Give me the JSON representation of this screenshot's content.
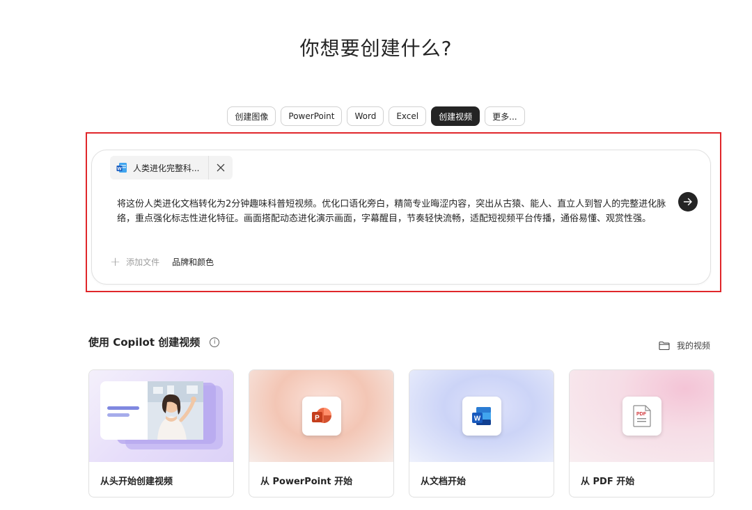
{
  "header": {
    "title": "你想要创建什么?"
  },
  "chips": [
    {
      "label": "创建图像",
      "active": false
    },
    {
      "label": "PowerPoint",
      "active": false
    },
    {
      "label": "Word",
      "active": false
    },
    {
      "label": "Excel",
      "active": false
    },
    {
      "label": "创建视频",
      "active": true
    },
    {
      "label": "更多...",
      "active": false
    }
  ],
  "composer": {
    "attachment": {
      "name": "人类进化完整科..."
    },
    "prompt": "将这份人类进化文档转化为2分钟趣味科普短视频。优化口语化旁白，精简专业晦涩内容，突出从古猿、能人、直立人到智人的完整进化脉络，重点强化标志性进化特征。画面搭配动态进化演示画面，字幕醒目，节奏轻快流畅，适配短视频平台传播，通俗易懂、观赏性强。",
    "add_file_label": "添加文件",
    "brand_colors_label": "品牌和颜色"
  },
  "section": {
    "title": "使用 Copilot 创建视频",
    "info_icon": "i",
    "my_videos_label": "我的视频"
  },
  "cards": [
    {
      "label": "从头开始创建视频"
    },
    {
      "label": "从 PowerPoint 开始",
      "icon_letter": "P",
      "accent": "#c43e1c"
    },
    {
      "label": "从文档开始",
      "icon_letter": "W",
      "accent": "#185abd"
    },
    {
      "label": "从 PDF 开始",
      "icon_text": "PDF",
      "accent": "#d13438"
    }
  ],
  "colors": {
    "highlight": "#e0262a",
    "active_chip": "#242424"
  }
}
